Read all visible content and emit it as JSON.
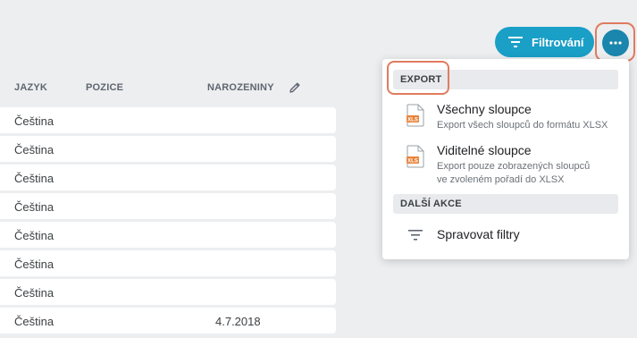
{
  "table": {
    "headers": {
      "language": "JAZYK",
      "position": "POZICE",
      "birthday": "NAROZENINY"
    },
    "rows": [
      {
        "language": "Čeština",
        "birthday": ""
      },
      {
        "language": "Čeština",
        "birthday": ""
      },
      {
        "language": "Čeština",
        "birthday": ""
      },
      {
        "language": "Čeština",
        "birthday": ""
      },
      {
        "language": "Čeština",
        "birthday": ""
      },
      {
        "language": "Čeština",
        "birthday": ""
      },
      {
        "language": "Čeština",
        "birthday": ""
      },
      {
        "language": "Čeština",
        "birthday": "4.7.2018"
      }
    ]
  },
  "toolbar": {
    "filter_label": "Filtrování",
    "filter_icon": "filter-lines-icon",
    "more_icon": "more-horizontal-icon"
  },
  "menu": {
    "export_section": "EXPORT",
    "all_columns_title": "Všechny sloupce",
    "all_columns_desc": "Export všech sloupců do formátu XLSX",
    "visible_columns_title": "Viditelné sloupce",
    "visible_columns_desc_line1": "Export pouze zobrazených sloupců",
    "visible_columns_desc_line2": "ve zvoleném pořadí do XLSX",
    "file_badge": "XLS",
    "other_section": "DALŠÍ AKCE",
    "manage_filters_title": "Spravovat filtry"
  },
  "colors": {
    "accent": "#1a9fc7",
    "more_button": "#1a86ad",
    "highlight_frame": "#e07b5f",
    "xls_icon": "#e8833a"
  }
}
